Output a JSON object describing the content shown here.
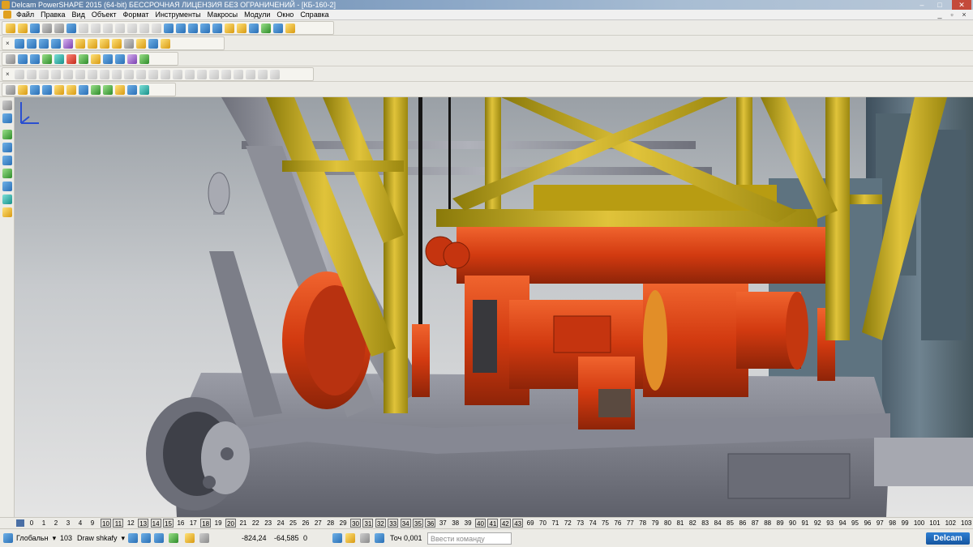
{
  "window": {
    "title": "Delcam PowerSHAPE 2015 (64-bit) БЕССРОЧНАЯ ЛИЦЕНЗИЯ БЕЗ ОГРАНИЧЕНИЙ - [КБ-160-2]",
    "controls": {
      "minimize": "–",
      "maximize": "□",
      "close": "✕"
    }
  },
  "menu": {
    "items": [
      "Файл",
      "Правка",
      "Вид",
      "Объект",
      "Формат",
      "Инструменты",
      "Макросы",
      "Модули",
      "Окно",
      "Справка"
    ],
    "mdi_controls": {
      "minimize": "_",
      "restore": "▫",
      "close": "×"
    }
  },
  "toolbars": {
    "close_glyph": "×"
  },
  "levels": {
    "items": [
      "0",
      "1",
      "2",
      "3",
      "4",
      "9",
      "10",
      "11",
      "12",
      "13",
      "14",
      "15",
      "16",
      "17",
      "18",
      "19",
      "20",
      "21",
      "22",
      "23",
      "24",
      "25",
      "26",
      "27",
      "28",
      "29",
      "30",
      "31",
      "32",
      "33",
      "34",
      "35",
      "36",
      "37",
      "38",
      "39",
      "40",
      "41",
      "42",
      "43",
      "69",
      "70",
      "71",
      "72",
      "73",
      "74",
      "75",
      "76",
      "77",
      "78",
      "79",
      "80",
      "81",
      "82",
      "83",
      "84",
      "85",
      "86",
      "87",
      "88",
      "89",
      "90",
      "91",
      "92",
      "93",
      "94",
      "95",
      "96",
      "97",
      "98",
      "99",
      "100",
      "101",
      "102",
      "103"
    ],
    "boxed": [
      "10",
      "11",
      "13",
      "14",
      "15",
      "18",
      "20",
      "30",
      "31",
      "32",
      "33",
      "34",
      "35",
      "36",
      "40",
      "41",
      "42",
      "43"
    ]
  },
  "status": {
    "coord_system": "Глобальн",
    "workplane_num": "103",
    "workplane_name": "Draw shkafy",
    "x": "-824,24",
    "y": "-64,585",
    "z": "0",
    "tolerance_label": "Точ",
    "tolerance_value": "0,001",
    "command_placeholder": "Ввести команду",
    "logo_text": "Delcam"
  },
  "colors": {
    "truss_yellow": "#c9a915",
    "machinery_red": "#d63a12",
    "frame_grey": "#7a7c86",
    "cabinet_blue": "#5a6b78"
  }
}
